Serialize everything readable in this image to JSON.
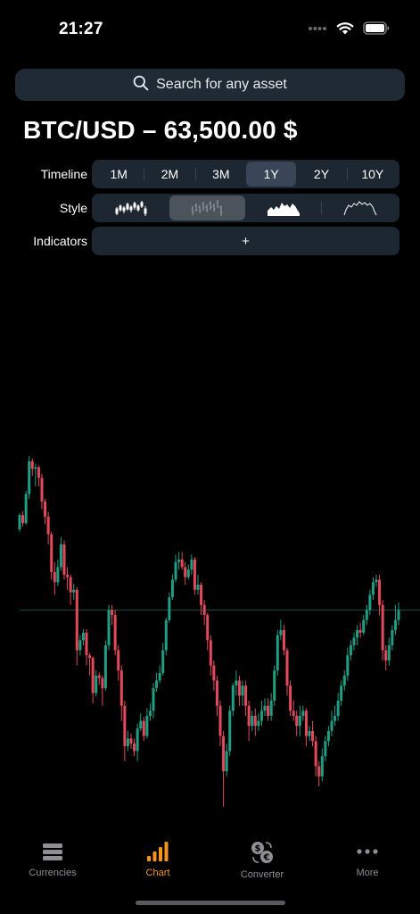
{
  "status_bar": {
    "time": "21:27"
  },
  "search": {
    "placeholder": "Search for any asset"
  },
  "pair": {
    "title": "BTC/USD – 63,500.00 $"
  },
  "timeline": {
    "label": "Timeline",
    "options": [
      "1M",
      "2M",
      "3M",
      "1Y",
      "2Y",
      "10Y"
    ],
    "selected": "1Y"
  },
  "style": {
    "label": "Style",
    "options": [
      "candles",
      "ohlc",
      "area",
      "line"
    ],
    "selected": "ohlc"
  },
  "indicators": {
    "label": "Indicators",
    "add_label": "+"
  },
  "colors": {
    "up": "#1f9e83",
    "down": "#e24a5b",
    "accent": "#f7941d",
    "inactive": "#8e8e93"
  },
  "tabs": [
    {
      "label": "Currencies",
      "icon": "stack-icon"
    },
    {
      "label": "Chart",
      "icon": "bar-chart-icon",
      "active": true
    },
    {
      "label": "Converter",
      "icon": "currency-exchange-icon"
    },
    {
      "label": "More",
      "icon": "ellipsis-icon"
    }
  ],
  "chart_data": {
    "type": "candlestick",
    "grid": false,
    "candles": [
      [
        0.57,
        0.598,
        0.565,
        0.602
      ],
      [
        0.598,
        0.582,
        0.576,
        0.606
      ],
      [
        0.582,
        0.64,
        0.579,
        0.646
      ],
      [
        0.64,
        0.705,
        0.63,
        0.715
      ],
      [
        0.705,
        0.69,
        0.676,
        0.71
      ],
      [
        0.69,
        0.693,
        0.655,
        0.7
      ],
      [
        0.693,
        0.672,
        0.655,
        0.696
      ],
      [
        0.672,
        0.625,
        0.61,
        0.68
      ],
      [
        0.625,
        0.595,
        0.58,
        0.63
      ],
      [
        0.595,
        0.56,
        0.54,
        0.605
      ],
      [
        0.56,
        0.485,
        0.47,
        0.565
      ],
      [
        0.485,
        0.465,
        0.44,
        0.505
      ],
      [
        0.465,
        0.495,
        0.458,
        0.51
      ],
      [
        0.495,
        0.54,
        0.488,
        0.555
      ],
      [
        0.54,
        0.48,
        0.47,
        0.548
      ],
      [
        0.48,
        0.475,
        0.45,
        0.495
      ],
      [
        0.475,
        0.445,
        0.42,
        0.48
      ],
      [
        0.445,
        0.45,
        0.43,
        0.462
      ],
      [
        0.45,
        0.33,
        0.3,
        0.455
      ],
      [
        0.33,
        0.35,
        0.32,
        0.36
      ],
      [
        0.35,
        0.365,
        0.34,
        0.372
      ],
      [
        0.365,
        0.32,
        0.3,
        0.372
      ],
      [
        0.32,
        0.315,
        0.28,
        0.325
      ],
      [
        0.315,
        0.245,
        0.225,
        0.318
      ],
      [
        0.245,
        0.28,
        0.238,
        0.29
      ],
      [
        0.28,
        0.275,
        0.262,
        0.286
      ],
      [
        0.275,
        0.255,
        0.22,
        0.28
      ],
      [
        0.255,
        0.34,
        0.25,
        0.35
      ],
      [
        0.34,
        0.41,
        0.33,
        0.42
      ],
      [
        0.41,
        0.4,
        0.38,
        0.42
      ],
      [
        0.4,
        0.33,
        0.32,
        0.41
      ],
      [
        0.33,
        0.29,
        0.27,
        0.34
      ],
      [
        0.29,
        0.22,
        0.19,
        0.3
      ],
      [
        0.22,
        0.14,
        0.11,
        0.23
      ],
      [
        0.14,
        0.155,
        0.13,
        0.17
      ],
      [
        0.155,
        0.145,
        0.135,
        0.165
      ],
      [
        0.145,
        0.13,
        0.12,
        0.155
      ],
      [
        0.13,
        0.175,
        0.11,
        0.185
      ],
      [
        0.175,
        0.19,
        0.17,
        0.205
      ],
      [
        0.19,
        0.16,
        0.15,
        0.198
      ],
      [
        0.16,
        0.2,
        0.155,
        0.215
      ],
      [
        0.2,
        0.21,
        0.19,
        0.225
      ],
      [
        0.21,
        0.255,
        0.195,
        0.265
      ],
      [
        0.255,
        0.27,
        0.248,
        0.285
      ],
      [
        0.27,
        0.285,
        0.265,
        0.3
      ],
      [
        0.285,
        0.33,
        0.28,
        0.345
      ],
      [
        0.33,
        0.39,
        0.32,
        0.395
      ],
      [
        0.39,
        0.435,
        0.385,
        0.445
      ],
      [
        0.435,
        0.47,
        0.43,
        0.48
      ],
      [
        0.47,
        0.505,
        0.465,
        0.52
      ],
      [
        0.505,
        0.51,
        0.49,
        0.525
      ],
      [
        0.51,
        0.495,
        0.49,
        0.525
      ],
      [
        0.495,
        0.475,
        0.46,
        0.505
      ],
      [
        0.475,
        0.49,
        0.47,
        0.5
      ],
      [
        0.49,
        0.51,
        0.48,
        0.52
      ],
      [
        0.51,
        0.45,
        0.44,
        0.515
      ],
      [
        0.45,
        0.46,
        0.44,
        0.48
      ],
      [
        0.46,
        0.42,
        0.4,
        0.465
      ],
      [
        0.42,
        0.4,
        0.38,
        0.43
      ],
      [
        0.4,
        0.35,
        0.33,
        0.405
      ],
      [
        0.35,
        0.3,
        0.28,
        0.36
      ],
      [
        0.3,
        0.27,
        0.25,
        0.31
      ],
      [
        0.27,
        0.22,
        0.2,
        0.28
      ],
      [
        0.22,
        0.16,
        0.14,
        0.23
      ],
      [
        0.16,
        0.09,
        0.02,
        0.17
      ],
      [
        0.09,
        0.13,
        0.08,
        0.145
      ],
      [
        0.13,
        0.21,
        0.12,
        0.22
      ],
      [
        0.21,
        0.26,
        0.2,
        0.265
      ],
      [
        0.26,
        0.27,
        0.24,
        0.29
      ],
      [
        0.27,
        0.24,
        0.22,
        0.28
      ],
      [
        0.24,
        0.26,
        0.22,
        0.27
      ],
      [
        0.26,
        0.22,
        0.2,
        0.27
      ],
      [
        0.22,
        0.18,
        0.15,
        0.23
      ],
      [
        0.18,
        0.2,
        0.17,
        0.21
      ],
      [
        0.2,
        0.18,
        0.16,
        0.215
      ],
      [
        0.18,
        0.19,
        0.17,
        0.205
      ],
      [
        0.19,
        0.21,
        0.18,
        0.23
      ],
      [
        0.21,
        0.22,
        0.2,
        0.235
      ],
      [
        0.22,
        0.2,
        0.19,
        0.235
      ],
      [
        0.2,
        0.23,
        0.19,
        0.245
      ],
      [
        0.23,
        0.29,
        0.22,
        0.3
      ],
      [
        0.29,
        0.36,
        0.28,
        0.37
      ],
      [
        0.36,
        0.37,
        0.35,
        0.39
      ],
      [
        0.37,
        0.33,
        0.32,
        0.38
      ],
      [
        0.33,
        0.26,
        0.24,
        0.335
      ],
      [
        0.26,
        0.21,
        0.2,
        0.27
      ],
      [
        0.21,
        0.2,
        0.19,
        0.23
      ],
      [
        0.2,
        0.18,
        0.16,
        0.21
      ],
      [
        0.18,
        0.2,
        0.16,
        0.22
      ],
      [
        0.2,
        0.21,
        0.19,
        0.22
      ],
      [
        0.21,
        0.16,
        0.14,
        0.215
      ],
      [
        0.16,
        0.17,
        0.15,
        0.18
      ],
      [
        0.17,
        0.15,
        0.14,
        0.19
      ],
      [
        0.15,
        0.1,
        0.08,
        0.16
      ],
      [
        0.1,
        0.08,
        0.06,
        0.11
      ],
      [
        0.08,
        0.12,
        0.07,
        0.135
      ],
      [
        0.12,
        0.15,
        0.11,
        0.16
      ],
      [
        0.15,
        0.17,
        0.14,
        0.18
      ],
      [
        0.17,
        0.19,
        0.16,
        0.21
      ],
      [
        0.19,
        0.2,
        0.18,
        0.22
      ],
      [
        0.2,
        0.23,
        0.19,
        0.245
      ],
      [
        0.23,
        0.26,
        0.22,
        0.27
      ],
      [
        0.26,
        0.28,
        0.25,
        0.29
      ],
      [
        0.28,
        0.32,
        0.27,
        0.335
      ],
      [
        0.32,
        0.34,
        0.31,
        0.35
      ],
      [
        0.34,
        0.355,
        0.33,
        0.365
      ],
      [
        0.355,
        0.37,
        0.34,
        0.38
      ],
      [
        0.37,
        0.365,
        0.355,
        0.385
      ],
      [
        0.365,
        0.39,
        0.36,
        0.4
      ],
      [
        0.39,
        0.41,
        0.38,
        0.42
      ],
      [
        0.41,
        0.44,
        0.4,
        0.45
      ],
      [
        0.44,
        0.465,
        0.43,
        0.475
      ],
      [
        0.465,
        0.47,
        0.455,
        0.48
      ],
      [
        0.47,
        0.42,
        0.4,
        0.48
      ],
      [
        0.42,
        0.33,
        0.31,
        0.43
      ],
      [
        0.33,
        0.31,
        0.29,
        0.34
      ],
      [
        0.31,
        0.34,
        0.3,
        0.355
      ],
      [
        0.34,
        0.37,
        0.33,
        0.38
      ],
      [
        0.37,
        0.39,
        0.36,
        0.42
      ],
      [
        0.39,
        0.41,
        0.38,
        0.425
      ]
    ]
  }
}
